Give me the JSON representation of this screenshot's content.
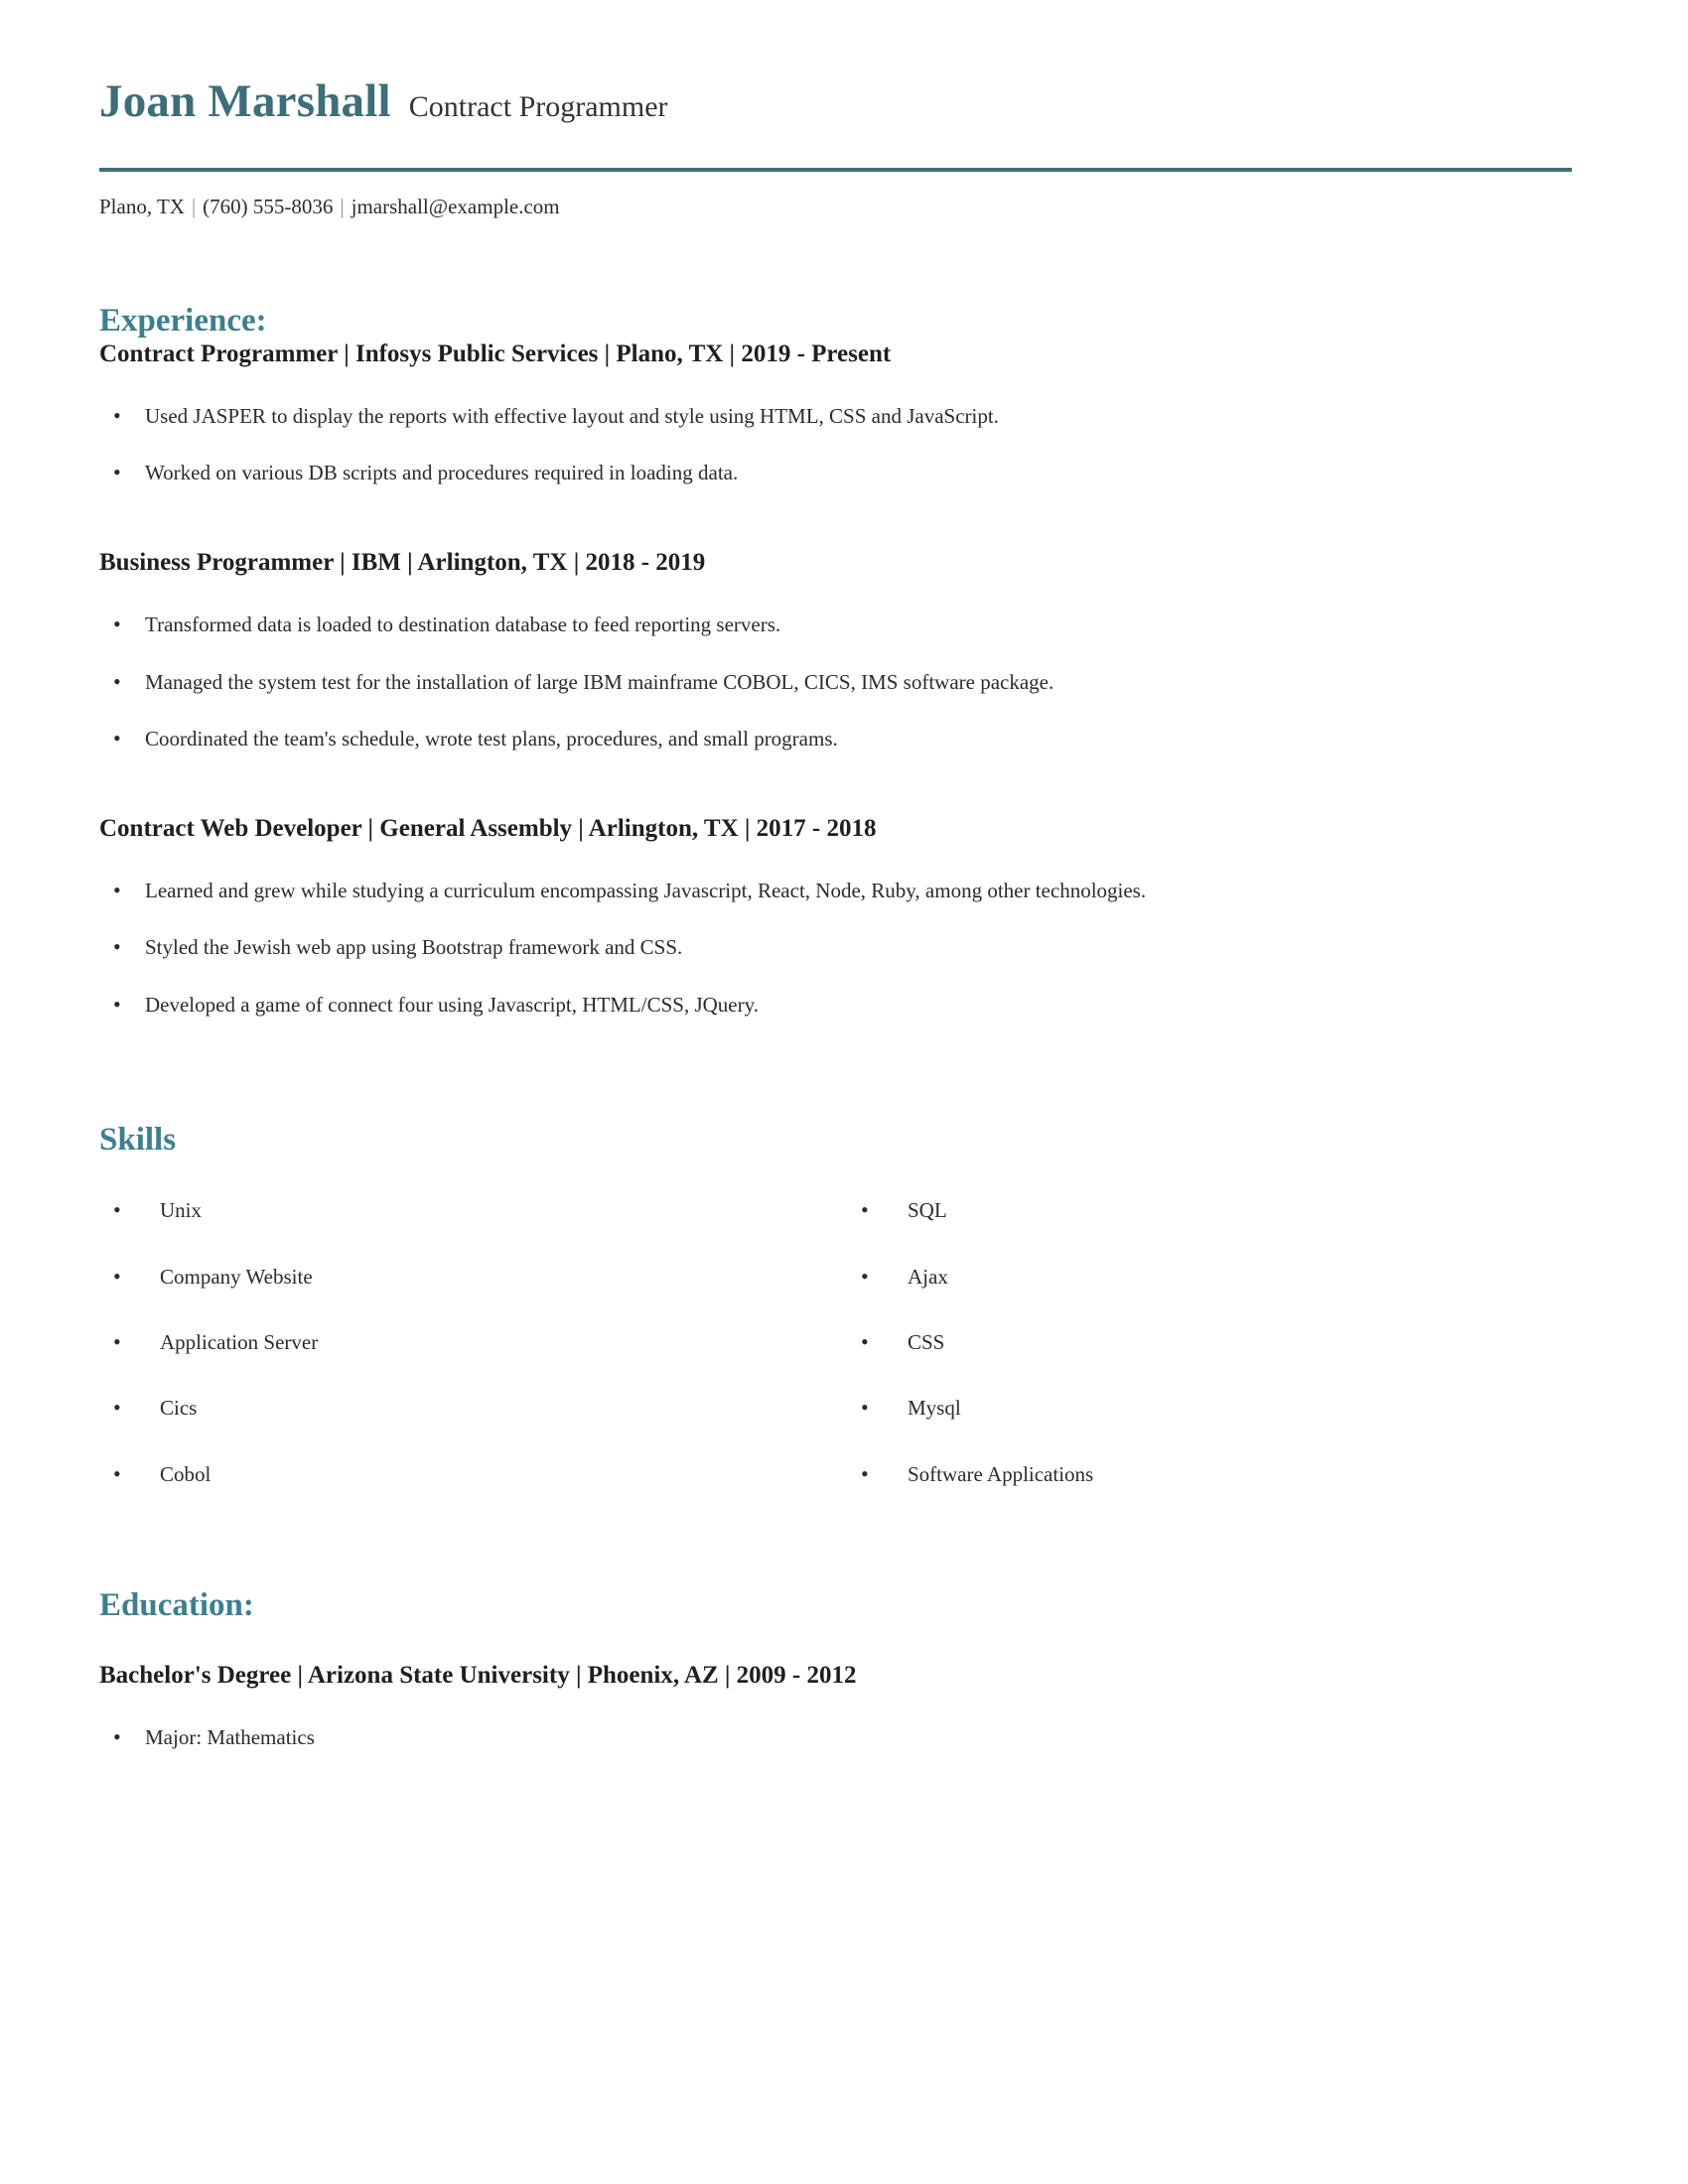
{
  "header": {
    "name": "Joan Marshall",
    "headline": "Contract Programmer",
    "separator": "|",
    "contact": {
      "location": "Plano, TX",
      "phone": "(760) 555-8036",
      "email": "jmarshall@example.com"
    }
  },
  "colors": {
    "accent_teal": "#3d6e7a",
    "heading_teal": "#3d7f8e",
    "body_text": "#2b2b2b",
    "entry_heading": "#1f1f1f",
    "page_background": "#ffffff"
  },
  "sections": {
    "experience": {
      "title": "Experience:",
      "entries": [
        {
          "heading": "Contract Programmer | Infosys Public Services | Plano, TX | 2019 - Present",
          "bullets": [
            "Used JASPER to display the reports with effective layout and style using HTML, CSS and JavaScript.",
            "Worked on various DB scripts and procedures required in loading data."
          ]
        },
        {
          "heading": "Business Programmer | IBM | Arlington, TX | 2018 - 2019",
          "bullets": [
            "Transformed data is loaded to destination database to feed reporting servers.",
            "Managed the system test for the installation of large IBM mainframe COBOL, CICS, IMS software package.",
            "Coordinated the team's schedule, wrote test plans, procedures, and small programs."
          ]
        },
        {
          "heading": "Contract Web Developer | General Assembly | Arlington, TX | 2017 - 2018",
          "bullets": [
            "Learned and grew while studying a curriculum encompassing Javascript, React, Node, Ruby, among other technologies.",
            "Styled the Jewish web app using Bootstrap framework and CSS.",
            "Developed a game of connect four using Javascript, HTML/CSS, JQuery."
          ]
        }
      ]
    },
    "skills": {
      "title": "Skills",
      "left_column": [
        "Unix",
        "Company Website",
        "Application Server",
        "Cics",
        "Cobol"
      ],
      "right_column": [
        "SQL",
        "Ajax",
        "CSS",
        "Mysql",
        "Software Applications"
      ]
    },
    "education": {
      "title": "Education:",
      "entries": [
        {
          "heading": "Bachelor's Degree | Arizona State University | Phoenix, AZ | 2009 - 2012",
          "bullets": [
            "Major: Mathematics"
          ]
        }
      ]
    }
  }
}
